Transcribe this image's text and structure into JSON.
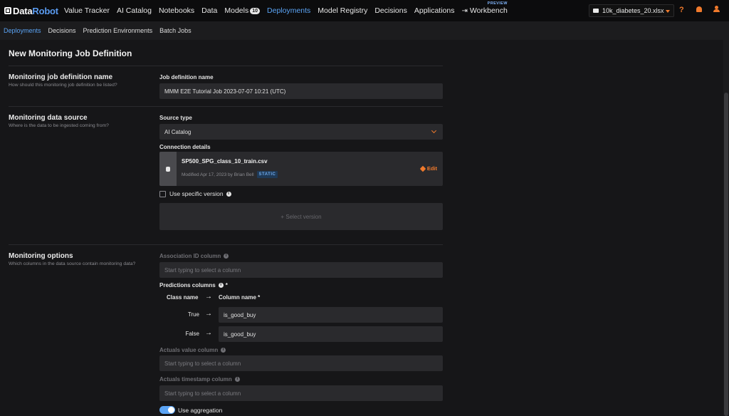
{
  "nav": {
    "brand_prefix": "Data",
    "brand_suffix": "Robot",
    "items": [
      {
        "label": "Value Tracker"
      },
      {
        "label": "AI Catalog"
      },
      {
        "label": "Notebooks"
      },
      {
        "label": "Data"
      },
      {
        "label": "Models",
        "badge": "10"
      },
      {
        "label": "Deployments"
      },
      {
        "label": "Model Registry"
      },
      {
        "label": "Decisions"
      },
      {
        "label": "Applications"
      }
    ],
    "workbench_label": "Workbench",
    "preview_tag": "PREVIEW",
    "active_item": "Deployments",
    "file_name": "10k_diabetes_20.xlsx",
    "help_glyph": "?"
  },
  "subnav": {
    "items": [
      "Deployments",
      "Decisions",
      "Prediction Environments",
      "Batch Jobs"
    ],
    "active_item": "Deployments"
  },
  "page": {
    "title": "New Monitoring Job Definition"
  },
  "sections": {
    "name": {
      "title": "Monitoring job definition name",
      "subtitle": "How should this monitoring job definition be listed?",
      "field_label": "Job definition name",
      "field_value": "MMM E2E Tutorial Job 2023-07-07 10:21 (UTC)"
    },
    "source": {
      "title": "Monitoring data source",
      "subtitle": "Where is the data to be ingested coming from?",
      "source_type_label": "Source type",
      "source_type_value": "AI Catalog",
      "connection_label": "Connection details",
      "connection_name": "SP500_SPG_class_10_train.csv",
      "connection_meta": "Modified Apr 17, 2023 by Brian Bell",
      "connection_badge": "STATIC",
      "edit_label": "Edit",
      "specific_version_label": "Use specific version",
      "select_version_label": "+ Select version"
    },
    "options": {
      "title": "Monitoring options",
      "subtitle": "Which columns in the data source contain monitoring data?",
      "association_label": "Association ID column",
      "association_placeholder": "Start typing to select a column",
      "predictions_label": "Predictions columns",
      "required_star": "*",
      "class_name_header": "Class name",
      "column_name_header": "Column name *",
      "arrow_glyph": "→",
      "mappings": [
        {
          "class": "True",
          "column": "is_good_buy"
        },
        {
          "class": "False",
          "column": "is_good_buy"
        }
      ],
      "actuals_value_label": "Actuals value column",
      "actuals_value_placeholder": "Start typing to select a column",
      "actuals_timestamp_label": "Actuals timestamp column",
      "actuals_timestamp_placeholder": "Start typing to select a column",
      "aggregation_label": "Use aggregation"
    }
  },
  "colors": {
    "accent_blue": "#5ba4f5",
    "accent_orange": "#f07a2c",
    "background": "#161618"
  }
}
